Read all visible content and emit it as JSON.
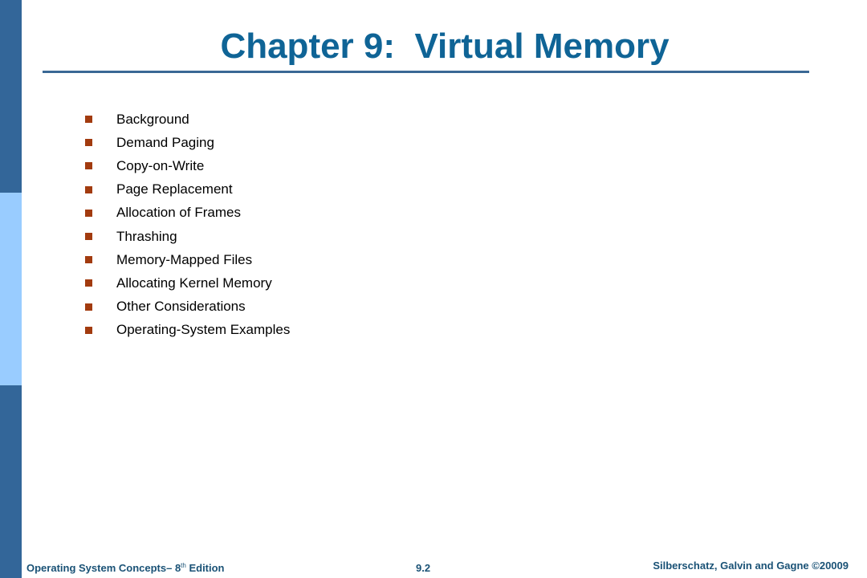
{
  "slide": {
    "title": "Chapter 9:  Virtual Memory",
    "bullets": [
      "Background",
      "Demand Paging",
      "Copy-on-Write",
      "Page Replacement",
      "Allocation of Frames",
      "Thrashing",
      "Memory-Mapped Files",
      "Allocating Kernel Memory",
      "Other Considerations",
      "Operating-System Examples"
    ],
    "bullet_icon": "square-bullet-icon",
    "colors": {
      "title": "#0f6496",
      "title_rule": "#3a6895",
      "bullet": "#a23b0f",
      "sidebar_dark": "#336699",
      "sidebar_light": "#99ccff",
      "footer_text": "#1a5276"
    }
  },
  "footer": {
    "book_title": "Operating System Concepts– 8",
    "edition_sup": "th",
    "edition_suffix": " Edition",
    "page_number": "9.2",
    "copyright": "Silberschatz, Galvin and Gagne ©20009"
  }
}
